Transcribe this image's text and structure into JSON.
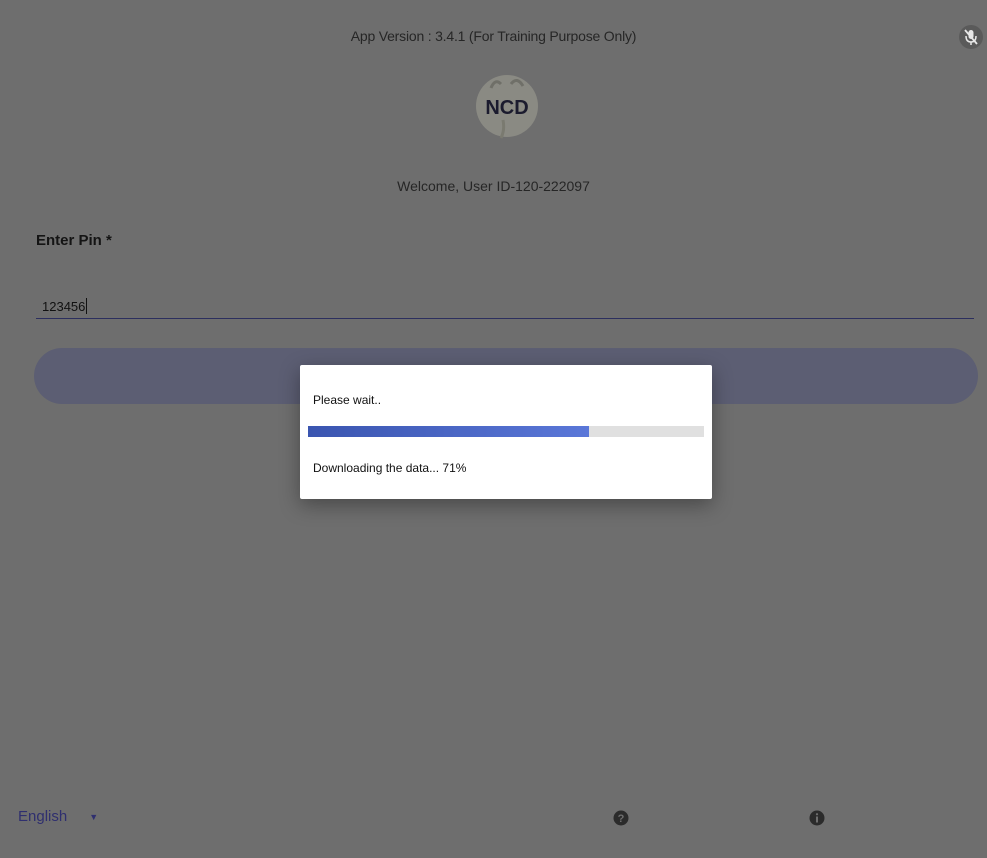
{
  "header": {
    "app_version": "App Version : 3.4.1 (For Training Purpose Only)",
    "logo_text": "NCD",
    "welcome": "Welcome, User ID-120-222097"
  },
  "pin": {
    "label": "Enter Pin *",
    "value": "123456"
  },
  "dialog": {
    "title": "Please wait..",
    "status": "Downloading the data... 71%",
    "progress_percent": 71
  },
  "footer": {
    "language": "English",
    "help_icon": "help-icon",
    "info_icon": "info-icon"
  },
  "icons": {
    "top_right": "mic-off-icon"
  },
  "colors": {
    "overlay_bg": "#6e6e6e",
    "button": "#5c5e73",
    "progress": "#4a64c8",
    "language_text": "#2f2f6f"
  }
}
